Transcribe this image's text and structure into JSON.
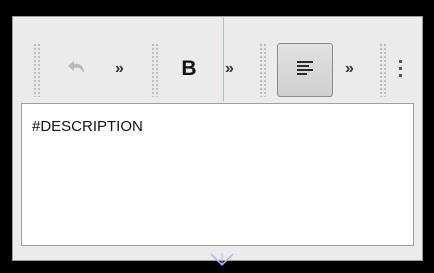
{
  "toolbar": {
    "undo_icon": "undo-icon",
    "more_glyph": "»",
    "bold_label": "B",
    "align_icon": "align-left-icon",
    "overflow_icon": "vertical-dots-icon"
  },
  "editor": {
    "text": "#DESCRIPTION"
  },
  "colors": {
    "guide": "#aab8ff",
    "active_button": "#d6d6d6"
  }
}
